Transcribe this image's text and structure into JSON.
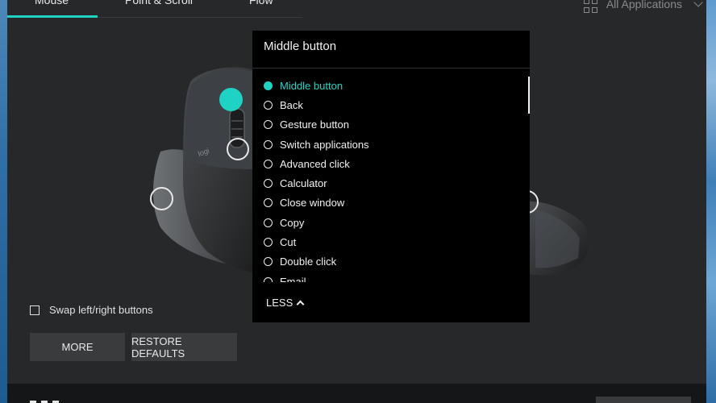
{
  "tabs": [
    {
      "label": "Mouse"
    },
    {
      "label": "Point & Scroll"
    },
    {
      "label": "Flow"
    }
  ],
  "app_selector": {
    "label": "All Applications",
    "icon": "grid-icon"
  },
  "left_panel": {
    "swap_label": "Swap left/right buttons",
    "swap_checked": false,
    "more_label": "MORE",
    "restore_label": "RESTORE DEFAULTS"
  },
  "popup": {
    "title": "Middle button",
    "options": [
      {
        "label": "Middle button",
        "selected": true
      },
      {
        "label": "Back",
        "selected": false
      },
      {
        "label": "Gesture button",
        "selected": false
      },
      {
        "label": "Switch applications",
        "selected": false
      },
      {
        "label": "Advanced click",
        "selected": false
      },
      {
        "label": "Calculator",
        "selected": false
      },
      {
        "label": "Close window",
        "selected": false
      },
      {
        "label": "Copy",
        "selected": false
      },
      {
        "label": "Cut",
        "selected": false
      },
      {
        "label": "Double click",
        "selected": false
      },
      {
        "label": "Email",
        "selected": false
      }
    ],
    "less_label": "LESS"
  },
  "colors": {
    "accent": "#1fd3c4",
    "window_bg": "#272829",
    "popup_bg": "#000000"
  }
}
